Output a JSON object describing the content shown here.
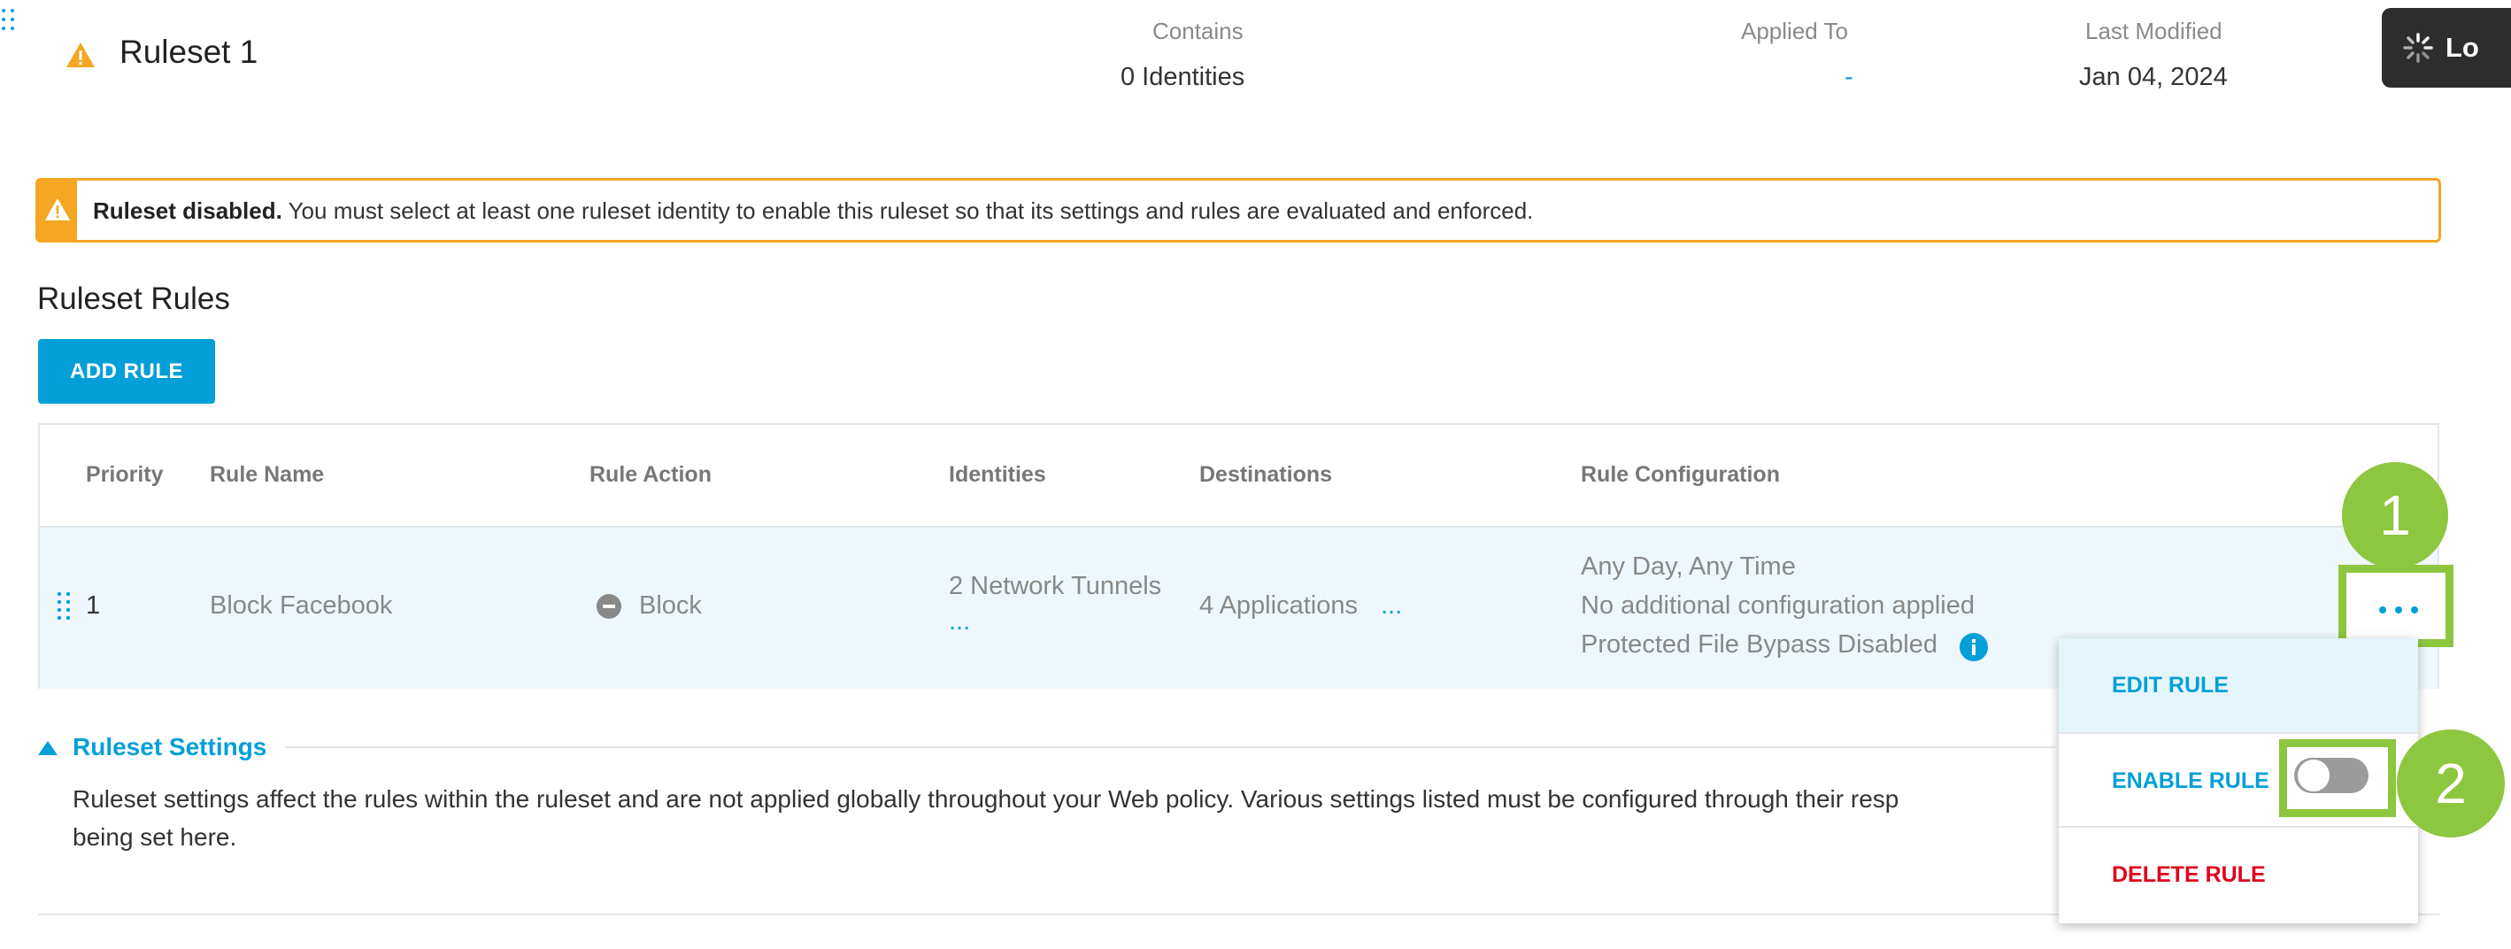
{
  "header": {
    "title": "Ruleset 1",
    "contains_label": "Contains",
    "contains_value": "0 Identities",
    "applied_label": "Applied To",
    "applied_value": "-",
    "modified_label": "Last Modified",
    "modified_value": "Jan 04, 2024",
    "loading_text": "Lo"
  },
  "banner": {
    "bold": "Ruleset disabled.",
    "text": " You must select at least one ruleset identity to enable this ruleset so that its settings and rules are evaluated and enforced."
  },
  "rules_section": {
    "title": "Ruleset Rules",
    "add_button": "ADD RULE"
  },
  "table": {
    "headers": [
      "Priority",
      "Rule Name",
      "Rule Action",
      "Identities",
      "Destinations",
      "Rule Configuration"
    ],
    "rows": [
      {
        "priority": "1",
        "name": "Block Facebook",
        "action": "Block",
        "identities": "2 Network Tunnels",
        "identities_more": "...",
        "destinations": "4 Applications",
        "destinations_more": "...",
        "config": [
          "Any Day, Any Time",
          "No additional configuration applied",
          "Protected File Bypass Disabled"
        ]
      }
    ]
  },
  "settings": {
    "title": "Ruleset Settings",
    "text": "Ruleset settings affect the rules within the ruleset and are not applied globally throughout your Web policy. Various settings listed must be configured through their resp",
    "text2": "being set here."
  },
  "menu": {
    "kebab": "...",
    "edit": "EDIT RULE",
    "enable": "ENABLE RULE",
    "delete": "DELETE RULE",
    "enable_toggle_on": false
  },
  "callouts": [
    "1",
    "2"
  ],
  "colors": {
    "accent": "#049fd9",
    "warning": "#f5a623",
    "callout": "#8dc63f",
    "delete": "#e2001a"
  },
  "icons": {
    "warning": "warning-triangle-icon",
    "block": "block-circle-icon",
    "info": "info-icon",
    "drag": "drag-handle-icon",
    "spinner": "spinner-icon",
    "collapse": "caret-up-icon"
  }
}
